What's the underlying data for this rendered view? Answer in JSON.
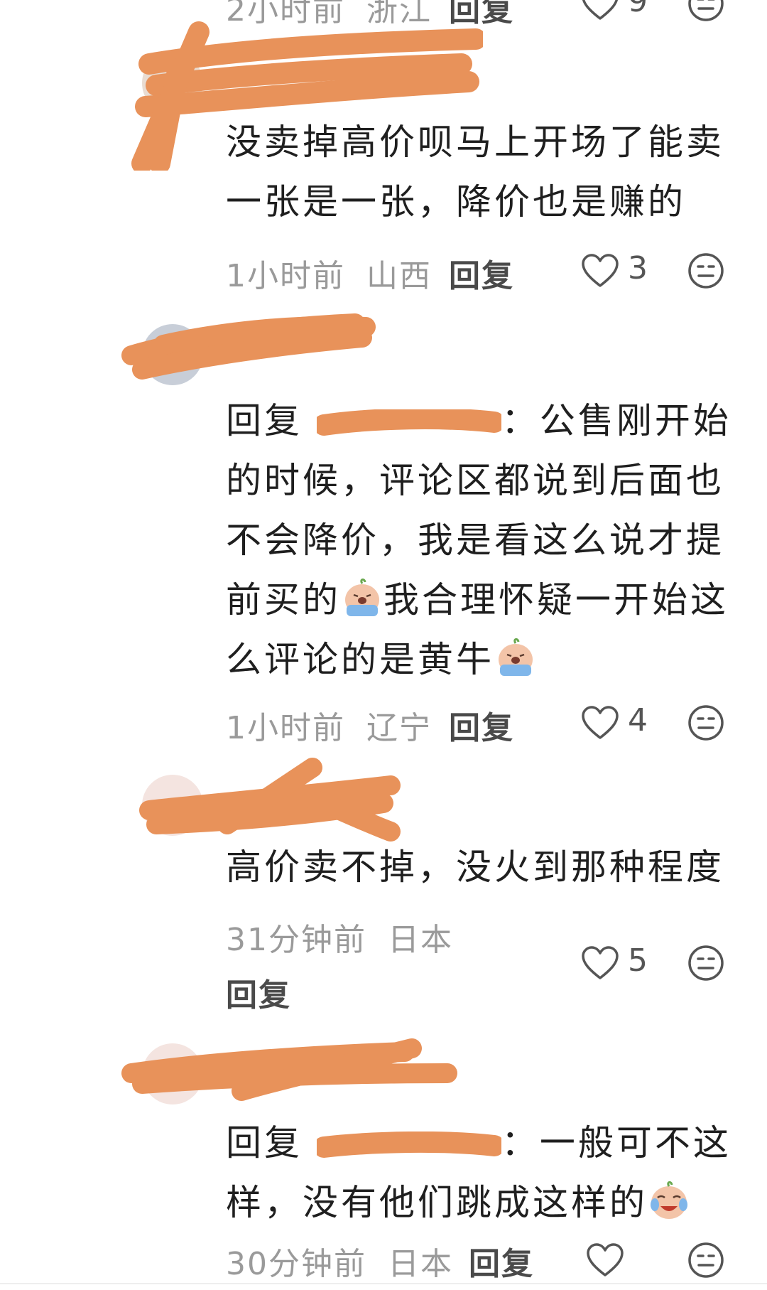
{
  "comments": [
    {
      "time": "2小时前",
      "location": "浙江",
      "reply_label": "回复",
      "likes": "9",
      "partial": true
    },
    {
      "text": "没卖掉高价呗马上开场了能卖一张是一张，降价也是赚的",
      "time": "1小时前",
      "location": "山西",
      "reply_label": "回复",
      "likes": "3"
    },
    {
      "reply_prefix": "回复",
      "text_after_mention": "：公售刚开始的时候，评论区都说到后面也不会降价，我是看这么说才提前买的",
      "text_part2": "我合理怀疑一开始这么评论的是黄牛",
      "time": "1小时前",
      "location": "辽宁",
      "reply_label": "回复",
      "likes": "4"
    },
    {
      "text": "高价卖不掉，没火到那种程度",
      "time": "31分钟前",
      "location": "日本",
      "reply_label": "回复",
      "likes": "5"
    },
    {
      "reply_prefix": "回复",
      "text_after_mention": "：一般可不这样，没有他们跳成这样的",
      "time": "30分钟前",
      "location": "日本",
      "reply_label": "回复",
      "likes": ""
    }
  ],
  "icons": {
    "like": "heart-outline-icon",
    "dislike": "neutral-face-icon",
    "emoji_cry": "crying-face-emoji",
    "emoji_laugh_cry": "laughing-crying-emoji"
  },
  "colors": {
    "redaction": "#e8925a",
    "meta_text": "#9a9a9a",
    "body_text": "#1f1f1f"
  }
}
